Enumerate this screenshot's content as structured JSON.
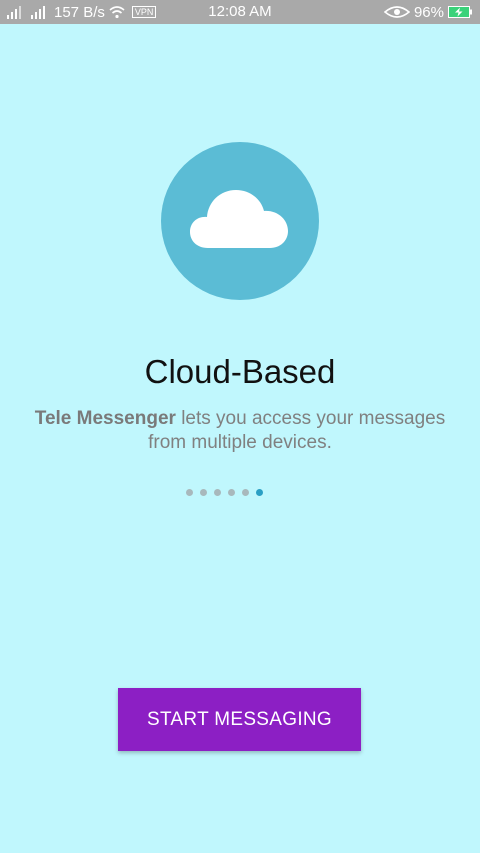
{
  "status_bar": {
    "network_speed": "157 B/s",
    "vpn_label": "VPN",
    "time": "12:08 AM",
    "battery": "96%"
  },
  "onboarding": {
    "title": "Cloud-Based",
    "description_bold": "Tele Messenger",
    "description_rest": " lets you access your messages from multiple devices.",
    "page_count": 6,
    "active_page": 6
  },
  "start_button": {
    "label": "START MESSAGING"
  },
  "colors": {
    "background": "#c0f7fd",
    "circle": "#5bbcd5",
    "button": "#8c1fc4",
    "active_dot": "#2a9fc4"
  }
}
